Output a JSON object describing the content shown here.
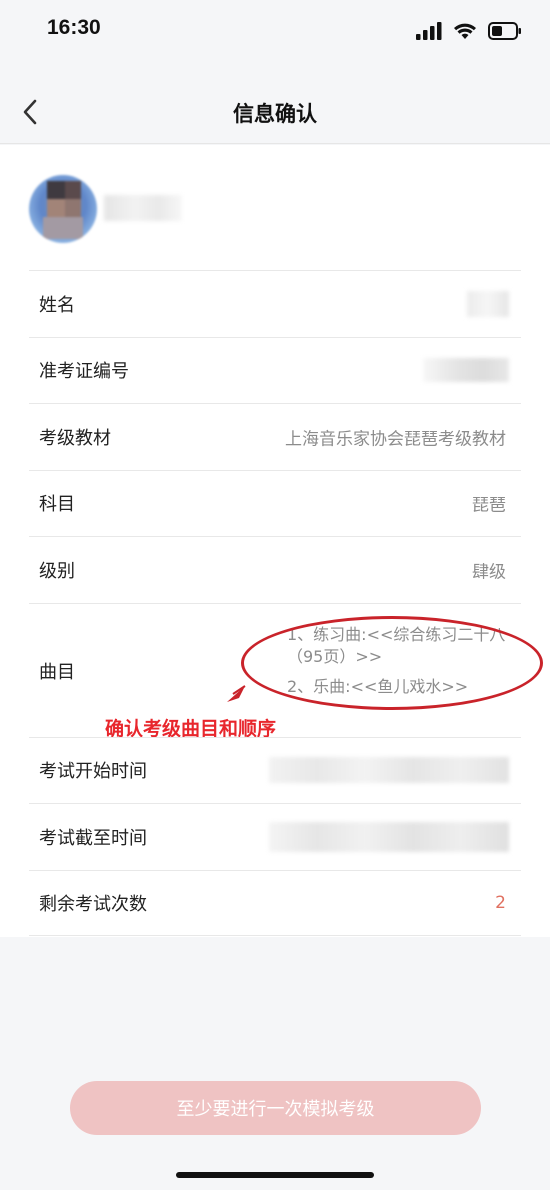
{
  "status_bar": {
    "time": "16:30"
  },
  "nav": {
    "title": "信息确认"
  },
  "fields": {
    "name_label": "姓名",
    "ticket_label": "准考证编号",
    "textbook_label": "考级教材",
    "textbook_value": "上海音乐家协会琵琶考级教材",
    "subject_label": "科目",
    "subject_value": "琵琶",
    "level_label": "级别",
    "level_value": "肆级",
    "pieces_label": "曲目",
    "pieces": [
      "1、练习曲:<<综合练习二十八（95页）>>",
      "2、乐曲:<<鱼儿戏水>>"
    ],
    "start_label": "考试开始时间",
    "end_label": "考试截至时间",
    "remaining_label": "剩余考试次数",
    "remaining_value": "2"
  },
  "annotation": {
    "text": "确认考级曲目和顺序",
    "color": "#e8262c"
  },
  "actions": {
    "submit_label": "至少要进行一次模拟考级"
  },
  "colors": {
    "accent_red": "#c9232a",
    "button_disabled": "#efc3c3",
    "remaining_count": "#e07060"
  }
}
